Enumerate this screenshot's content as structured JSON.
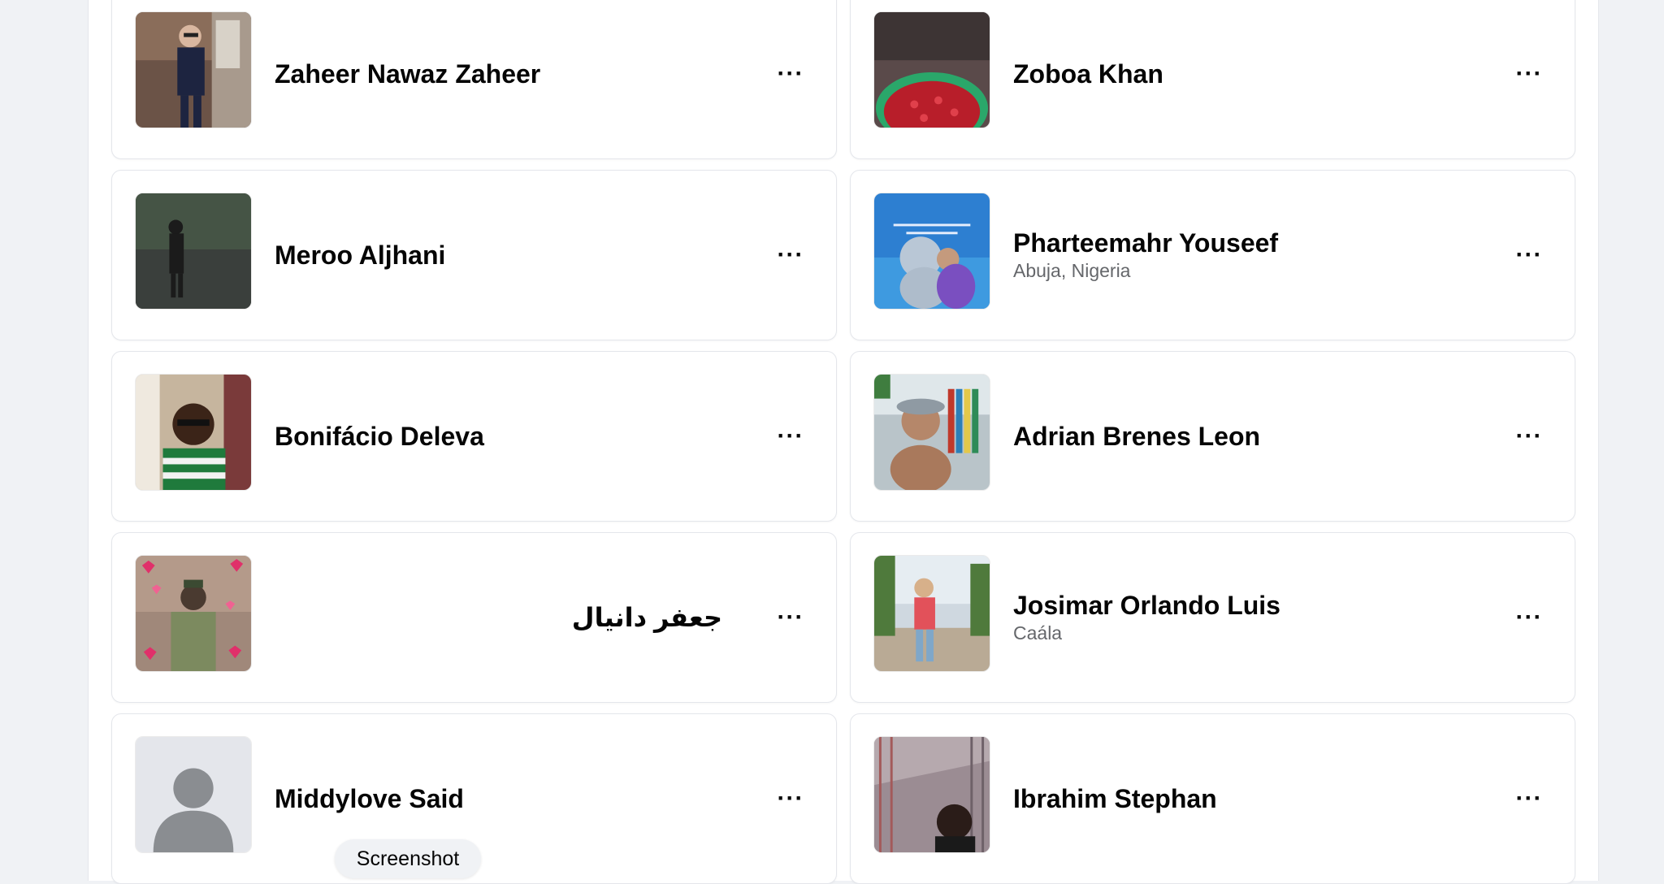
{
  "people": [
    {
      "name": "Zaheer Nawaz Zaheer",
      "subtitle": ""
    },
    {
      "name": "Zoboa Khan",
      "subtitle": ""
    },
    {
      "name": "Meroo Aljhani",
      "subtitle": ""
    },
    {
      "name": "Pharteemahr Youseef",
      "subtitle": "Abuja, Nigeria"
    },
    {
      "name": "Bonifácio Deleva",
      "subtitle": ""
    },
    {
      "name": "Adrian Brenes Leon",
      "subtitle": ""
    },
    {
      "name": "جعفر دانیال",
      "subtitle": ""
    },
    {
      "name": "Josimar Orlando Luis",
      "subtitle": "Caála"
    },
    {
      "name": "Middylove Said",
      "subtitle": ""
    },
    {
      "name": "Ibrahim Stephan",
      "subtitle": ""
    }
  ],
  "more_label": "···",
  "tooltip": {
    "label": "Screenshot"
  }
}
